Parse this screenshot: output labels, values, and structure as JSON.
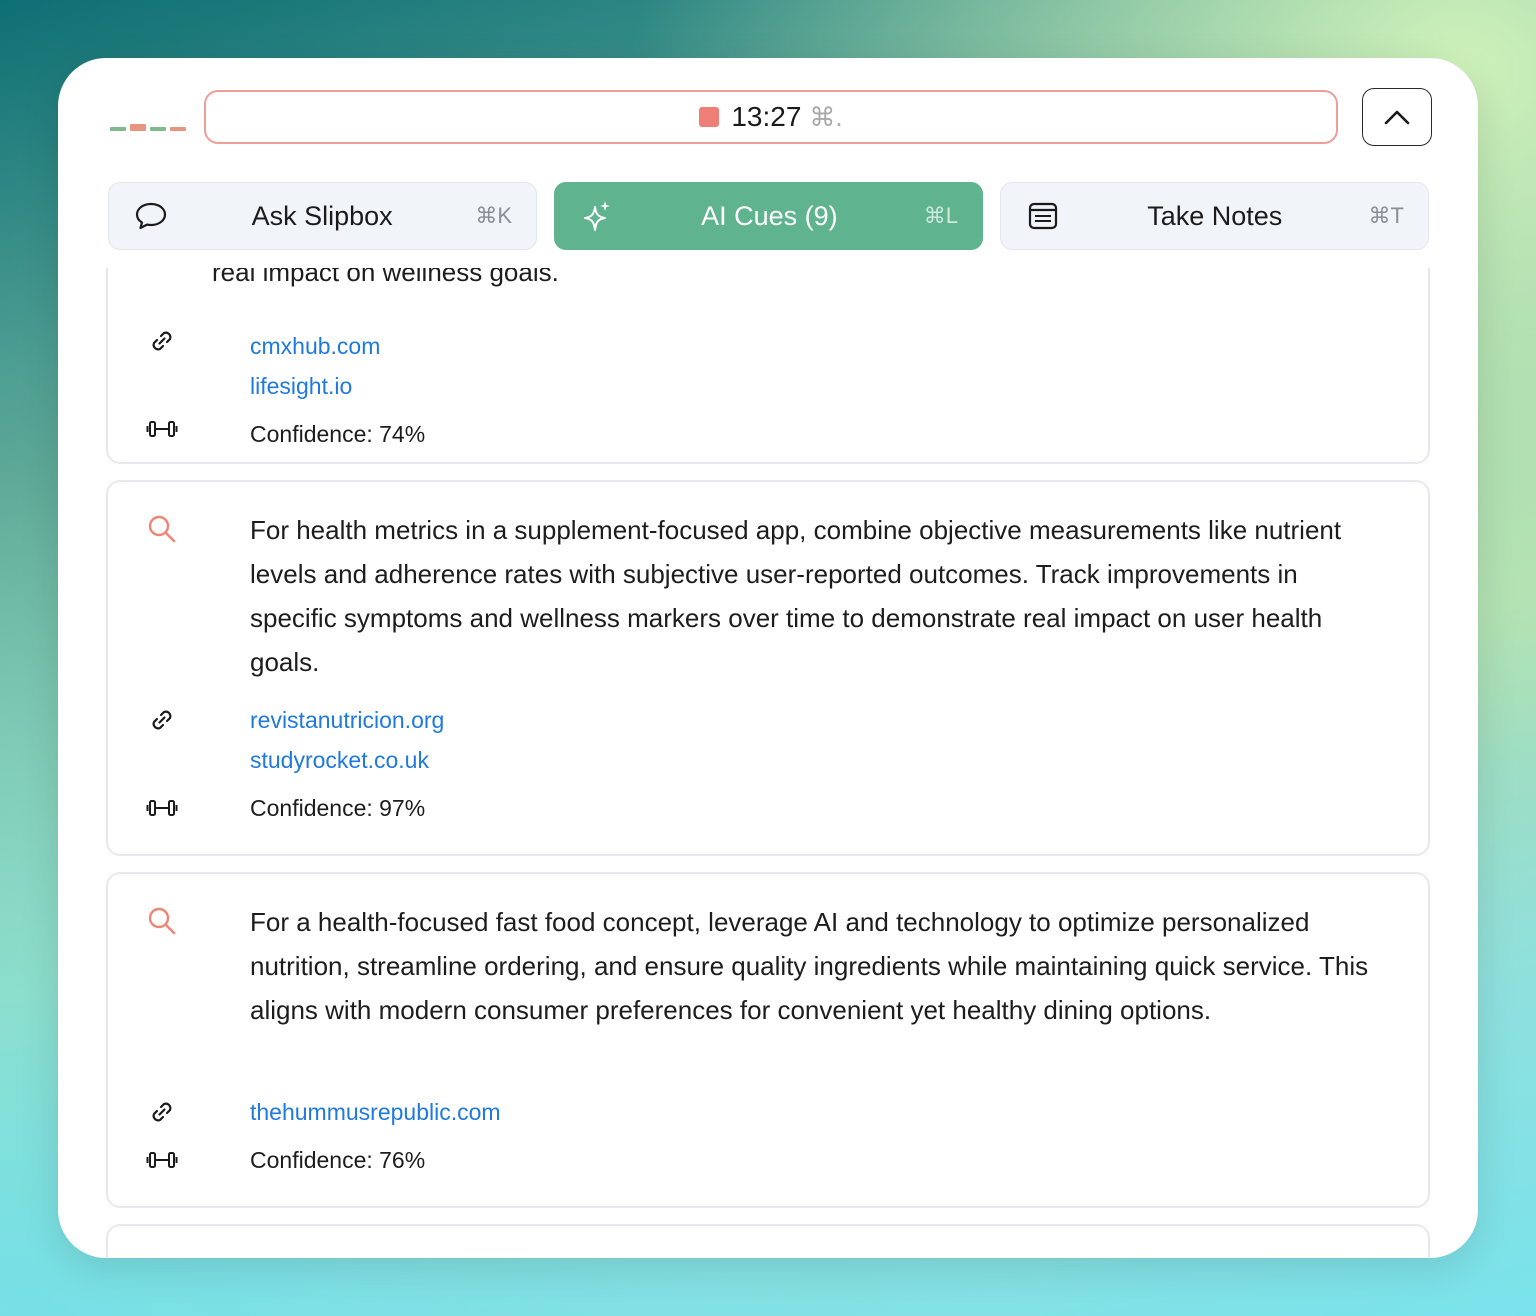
{
  "recorder": {
    "time": "13:27",
    "shortcut": "⌘."
  },
  "colors": {
    "accent": "#5fb38f",
    "stop": "#ef7f76",
    "link": "#1f7ae0",
    "search_icon": "#ef8574"
  },
  "tabs": [
    {
      "label": "Ask Slipbox",
      "shortcut": "⌘K",
      "icon": "chat-bubble-icon",
      "active": false
    },
    {
      "label": "AI Cues (9)",
      "shortcut": "⌘L",
      "icon": "sparkle-icon",
      "active": true
    },
    {
      "label": "Take Notes",
      "shortcut": "⌘T",
      "icon": "notes-icon",
      "active": false
    }
  ],
  "cards": [
    {
      "text_tail": "real impact on wellness goals.",
      "links": [
        "cmxhub.com",
        "lifesight.io"
      ],
      "confidence": "Confidence: 74%"
    },
    {
      "text": "For health metrics in a supplement-focused app, combine objective measurements like nutrient levels and adherence rates with subjective user-reported outcomes. Track improvements in specific symptoms and wellness markers over time to demonstrate real impact on user health goals.",
      "links": [
        "revistanutricion.org",
        "studyrocket.co.uk"
      ],
      "confidence": "Confidence: 97%"
    },
    {
      "text": "For a health-focused fast food concept, leverage AI and technology to optimize personalized nutrition, streamline ordering, and ensure quality ingredients while maintaining quick service. This aligns with modern consumer preferences for convenient yet healthy dining options.",
      "links": [
        "thehummusrepublic.com"
      ],
      "confidence": "Confidence: 76%"
    }
  ]
}
